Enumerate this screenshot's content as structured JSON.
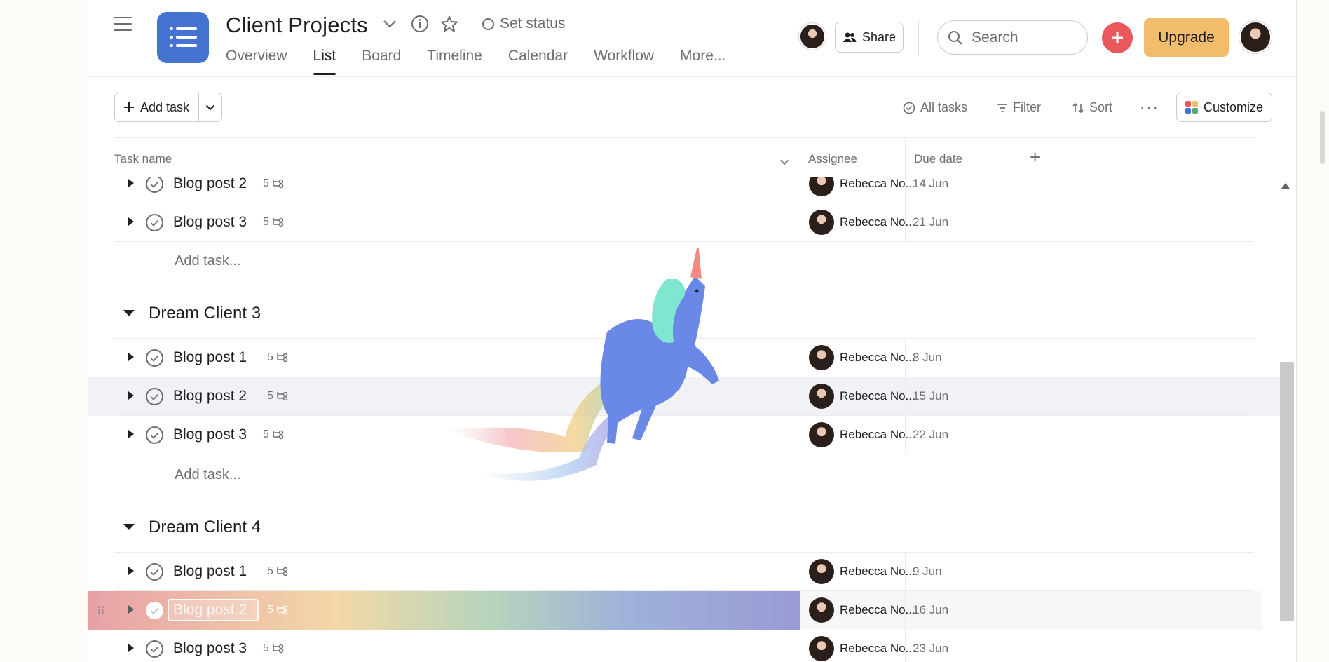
{
  "header": {
    "project_title": "Client Projects",
    "set_status": "Set status",
    "tabs": [
      "Overview",
      "List",
      "Board",
      "Timeline",
      "Calendar",
      "Workflow",
      "More..."
    ],
    "active_tab": "List",
    "share_label": "Share",
    "search_placeholder": "Search",
    "upgrade_label": "Upgrade"
  },
  "toolbar": {
    "add_task_label": "Add task",
    "all_tasks_label": "All tasks",
    "filter_label": "Filter",
    "sort_label": "Sort",
    "more_label": "···",
    "customize_label": "Customize"
  },
  "columns": {
    "task_name": "Task name",
    "assignee": "Assignee",
    "due_date": "Due date",
    "add_column": "+"
  },
  "rows_top": [
    {
      "name": "Blog post 2",
      "subtasks": "5",
      "assignee": "Rebecca No...",
      "due": "14 Jun"
    },
    {
      "name": "Blog post 3",
      "subtasks": "5",
      "assignee": "Rebecca No...",
      "due": "21 Jun"
    }
  ],
  "add_task_inline": "Add task...",
  "sections": [
    {
      "title": "Dream Client 3",
      "rows": [
        {
          "name": "Blog post 1",
          "subtasks": "5",
          "assignee": "Rebecca No...",
          "due": "8 Jun"
        },
        {
          "name": "Blog post 2",
          "subtasks": "5",
          "assignee": "Rebecca No...",
          "due": "15 Jun"
        },
        {
          "name": "Blog post 3",
          "subtasks": "5",
          "assignee": "Rebecca No...",
          "due": "22 Jun"
        }
      ]
    },
    {
      "title": "Dream Client 4",
      "rows": [
        {
          "name": "Blog post 1",
          "subtasks": "5",
          "assignee": "Rebecca No...",
          "due": "9 Jun"
        },
        {
          "name": "Blog post 2",
          "subtasks": "5",
          "assignee": "Rebecca No...",
          "due": "16 Jun"
        },
        {
          "name": "Blog post 3",
          "subtasks": "5",
          "assignee": "Rebecca No...",
          "due": "23 Jun"
        }
      ]
    }
  ],
  "colors": {
    "project_icon": "#4573d2",
    "add_button": "#e8585d",
    "upgrade": "#f1bd6c"
  }
}
